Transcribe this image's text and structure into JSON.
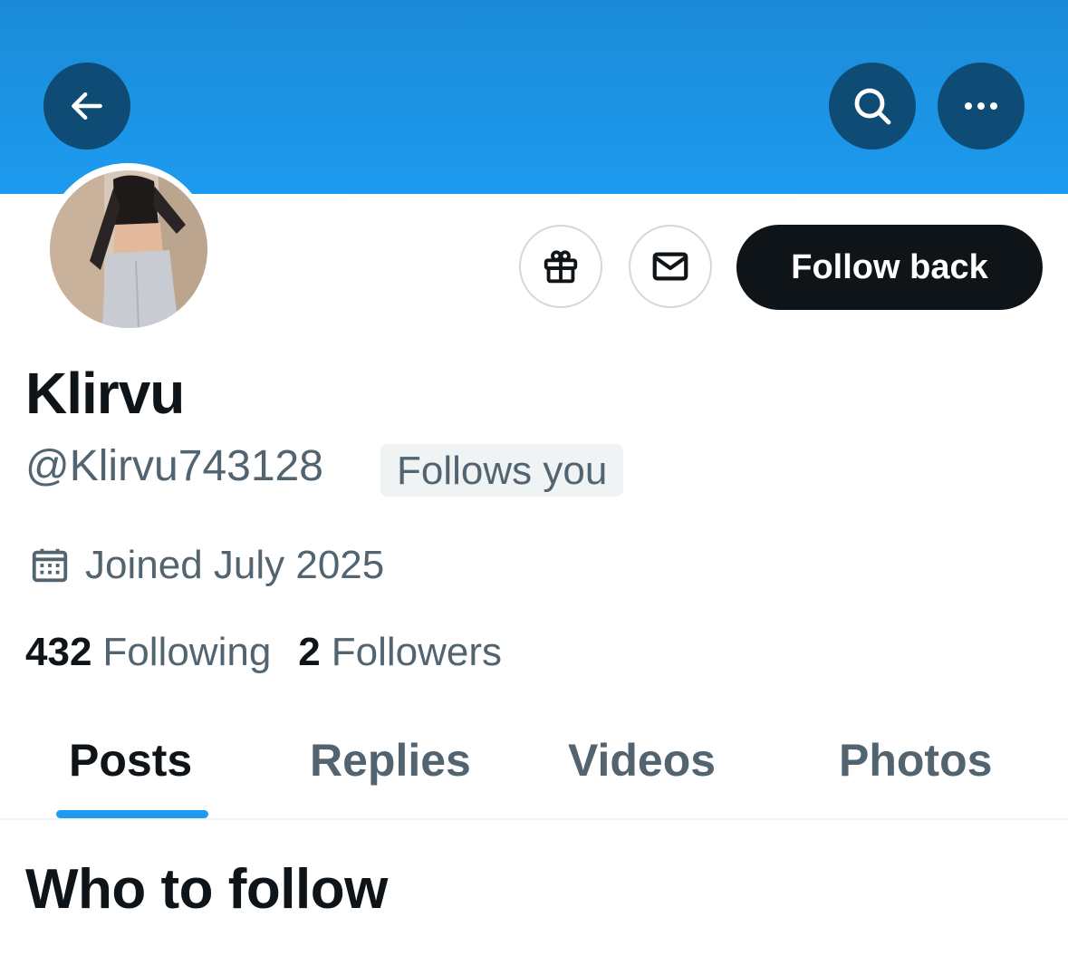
{
  "header": {
    "back_icon": "arrow-left-icon",
    "search_icon": "search-icon",
    "more_icon": "more-horizontal-icon",
    "banner_color": "#1d9bf0"
  },
  "actions": {
    "gift_icon": "gift-icon",
    "message_icon": "envelope-icon",
    "follow_back_label": "Follow back"
  },
  "profile": {
    "display_name": "Klirvu",
    "handle": "@Klirvu743128",
    "follows_you_badge": "Follows you",
    "joined": "Joined July 2025",
    "following_count": "432",
    "following_label": "Following",
    "followers_count": "2",
    "followers_label": "Followers"
  },
  "tabs": [
    {
      "label": "Posts",
      "active": true
    },
    {
      "label": "Replies",
      "active": false
    },
    {
      "label": "Videos",
      "active": false
    },
    {
      "label": "Photos",
      "active": false
    }
  ],
  "sections": {
    "who_to_follow_title": "Who to follow"
  },
  "colors": {
    "accent": "#1d9bf0",
    "text_primary": "#0f1419",
    "text_secondary": "#536471"
  }
}
